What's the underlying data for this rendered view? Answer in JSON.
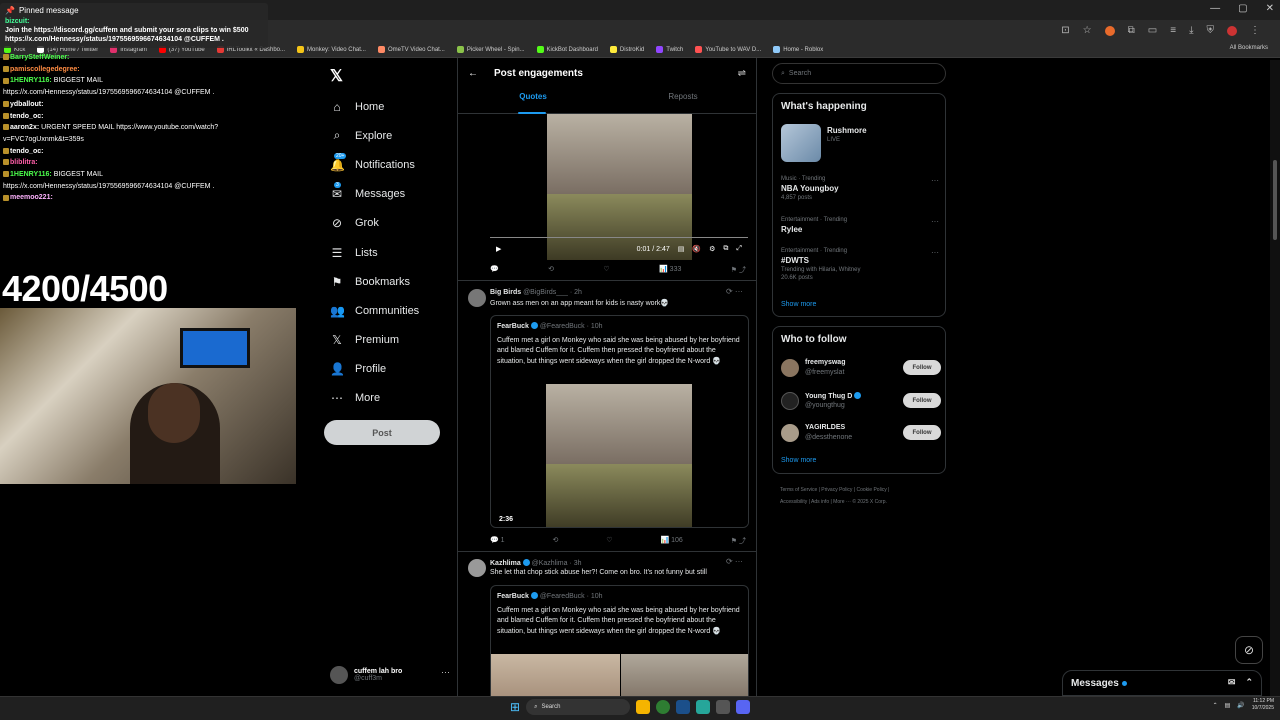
{
  "browser": {
    "controls": [
      "—",
      "▢",
      "✕"
    ],
    "bookmarks": [
      {
        "label": "Kick",
        "color": "#53fc18"
      },
      {
        "label": "(14) Home / Twitter",
        "color": "#ffffff"
      },
      {
        "label": "Instagram",
        "color": "#e1306c"
      },
      {
        "label": "(37) YouTube",
        "color": "#ff0000"
      },
      {
        "label": "IRLToolkit « Dashbo...",
        "color": "#e53935"
      },
      {
        "label": "Monkey: Video Chat...",
        "color": "#f5c518"
      },
      {
        "label": "OmeTV Video Chat...",
        "color": "#ff8a65"
      },
      {
        "label": "Picker Wheel - Spin...",
        "color": "#8bc34a"
      },
      {
        "label": "KickBot Dashboard",
        "color": "#53fc18"
      },
      {
        "label": "DistroKid",
        "color": "#ffeb3b"
      },
      {
        "label": "Twitch",
        "color": "#9146ff"
      },
      {
        "label": "YouTube to WAV D...",
        "color": "#ff5252"
      },
      {
        "label": "Home - Roblox",
        "color": "#90caf9"
      }
    ],
    "all_bookmarks": "All Bookmarks"
  },
  "stream_overlay": {
    "pinned_title": "Pinned message",
    "pinned_user": "bizcuit:",
    "pinned_text_1": "Join the https://discord.gg/cuffem and submit your sora clips to win $500",
    "pinned_text_2": "https://x.com/Hennessy/status/1975569596674634104 @CUFFEM .",
    "chat": [
      {
        "user": "BarrySteffWeiner:",
        "color": "#4cff4c",
        "text": ""
      },
      {
        "user": "pamiscollegedegree:",
        "color": "#ff8c42",
        "text": ""
      },
      {
        "user": "1HENRY116:",
        "color": "#4cff4c",
        "text": "BIGGEST MAIL"
      },
      {
        "user": "",
        "color": "#ffffff",
        "text": "https://x.com/Hennessy/status/1975569596674634104 @CUFFEM ."
      },
      {
        "user": "ydballout:",
        "color": "#ffffff",
        "text": ""
      },
      {
        "user": "tendo_oc:",
        "color": "#ffffff",
        "text": ""
      },
      {
        "user": "aaron2x:",
        "color": "#ffffff",
        "text": "URGENT SPEED MAIL https://www.youtube.com/watch?"
      },
      {
        "user": "",
        "color": "#ffffff",
        "text": "v=FVC7ogUxnmk&t=359s"
      },
      {
        "user": "tendo_oc:",
        "color": "#ffffff",
        "text": ""
      },
      {
        "user": "bliblitra:",
        "color": "#ff5ea8",
        "text": ""
      },
      {
        "user": "1HENRY116:",
        "color": "#4cff4c",
        "text": "BIGGEST MAIL"
      },
      {
        "user": "",
        "color": "#ffffff",
        "text": "https://x.com/Hennessy/status/1975569596674634104 @CUFFEM ."
      },
      {
        "user": "meemoo221:",
        "color": "#ffb3ff",
        "text": ""
      }
    ],
    "goal": "4200/4500"
  },
  "x_sidebar": {
    "logo": "𝕏",
    "nav": [
      {
        "label": "Home",
        "icon": "⌂",
        "name": "home",
        "badge": ""
      },
      {
        "label": "Explore",
        "icon": "⌕",
        "name": "explore",
        "badge": ""
      },
      {
        "label": "Notifications",
        "icon": "🔔",
        "name": "notifications",
        "badge": "20+"
      },
      {
        "label": "Messages",
        "icon": "✉",
        "name": "messages",
        "badge": "3"
      },
      {
        "label": "Grok",
        "icon": "⊘",
        "name": "grok",
        "badge": ""
      },
      {
        "label": "Lists",
        "icon": "☰",
        "name": "lists",
        "badge": ""
      },
      {
        "label": "Bookmarks",
        "icon": "⚑",
        "name": "bookmarks",
        "badge": ""
      },
      {
        "label": "Communities",
        "icon": "👥",
        "name": "communities",
        "badge": ""
      },
      {
        "label": "Premium",
        "icon": "𝕏",
        "name": "premium",
        "badge": ""
      },
      {
        "label": "Profile",
        "icon": "👤",
        "name": "profile",
        "badge": ""
      },
      {
        "label": "More",
        "icon": "⋯",
        "name": "more",
        "badge": ""
      }
    ],
    "post_button": "Post",
    "account_name": "cuffem lah bro",
    "account_handle": "@cuff3m"
  },
  "main": {
    "title": "Post engagements",
    "tabs": [
      "Quotes",
      "Reposts"
    ],
    "video1": {
      "time": "0:01 / 2:47"
    },
    "post1_actions": {
      "reply": "",
      "repost": "",
      "like": "",
      "views": "333"
    },
    "tweet2": {
      "name": "Big Birds",
      "handle": "@BigBirds___",
      "time": "· 2h",
      "text": "Grown ass men on an app meant for kids is nasty work💀",
      "quote_name": "FearBuck",
      "quote_handle": "@FearedBuck",
      "quote_time": "· 10h",
      "quote_text": "Cuffem met a girl on Monkey who said she was being abused by her boyfriend and blamed Cuffem for it. Cuffem then pressed the boyfriend about the situation, but things went sideways when the girl dropped the N-word 💀",
      "video_time": "2:36",
      "reply_count": "1",
      "views": "106"
    },
    "tweet3": {
      "name": "Kazhlima",
      "handle": "@Kazhlima",
      "time": "· 3h",
      "text": "She let that chop stick abuse her?! Come on bro. It's not funny but still",
      "quote_name": "FearBuck",
      "quote_handle": "@FearedBuck",
      "quote_time": "· 10h",
      "quote_text": "Cuffem met a girl on Monkey who said she was being abused by her boyfriend and blamed Cuffem for it. Cuffem then pressed the boyfriend about the situation, but things went sideways when the girl dropped the N-word 💀"
    }
  },
  "right": {
    "search_placeholder": "Search",
    "whats_happening": "What's happening",
    "live_event": {
      "title": "Rushmore",
      "status": "LIVE"
    },
    "trends": [
      {
        "meta": "Music · Trending",
        "name": "NBA Youngboy",
        "posts": "4,857 posts"
      },
      {
        "meta": "Entertainment · Trending",
        "name": "Rylee",
        "posts": ""
      },
      {
        "meta": "Entertainment · Trending",
        "name": "#DWTS",
        "posts": "Trending with Hilaria, Whitney",
        "posts2": "20.6K posts"
      }
    ],
    "show_more": "Show more",
    "who_to_follow": "Who to follow",
    "follow": [
      {
        "name": "freemyswag",
        "handle": "@freemyslat",
        "btn": "Follow"
      },
      {
        "name": "Young Thug D",
        "handle": "@youngthug",
        "btn": "Follow"
      },
      {
        "name": "YAGIRLDES",
        "handle": "@dessthenone",
        "btn": "Follow"
      }
    ],
    "show_more_2": "Show more",
    "footer_1": "Terms of Service | Privacy Policy | Cookie Policy |",
    "footer_2": "Accessibility | Ads info | More ··· © 2025 X Corp."
  },
  "messages_drawer": {
    "label": "Messages"
  },
  "taskbar": {
    "search": "Search",
    "time": "11:12 PM",
    "date": "10/7/2025"
  }
}
